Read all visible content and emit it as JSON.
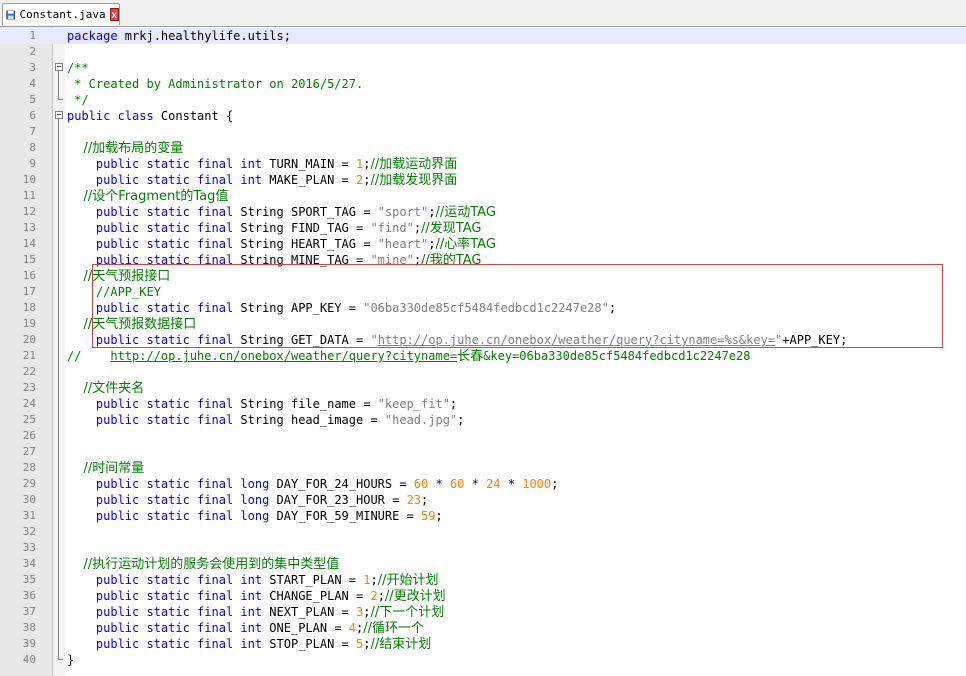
{
  "tab": {
    "title": "Constant.java",
    "close_glyph": "x"
  },
  "lines": [
    {
      "n": "1",
      "current": true,
      "segs": [
        {
          "c": "kw",
          "t": "package"
        },
        {
          "c": "",
          "t": " mrkj.healthylife.utils;"
        }
      ]
    },
    {
      "n": "2",
      "segs": []
    },
    {
      "n": "3",
      "segs": [
        {
          "c": "cm",
          "t": "/**"
        }
      ]
    },
    {
      "n": "4",
      "segs": [
        {
          "c": "cm",
          "t": " * Created by Administrator on 2016/5/27."
        }
      ]
    },
    {
      "n": "5",
      "segs": [
        {
          "c": "cm",
          "t": " */"
        }
      ]
    },
    {
      "n": "6",
      "segs": [
        {
          "c": "kw",
          "t": "public class"
        },
        {
          "c": "",
          "t": " Constant {"
        }
      ]
    },
    {
      "n": "7",
      "segs": []
    },
    {
      "n": "8",
      "segs": [
        {
          "c": "cmc",
          "t": "    //加载布局的变量"
        }
      ]
    },
    {
      "n": "9",
      "segs": [
        {
          "c": "kw",
          "t": "    public static final int"
        },
        {
          "c": "",
          "t": " TURN_MAIN = "
        },
        {
          "c": "num",
          "t": "1"
        },
        {
          "c": "",
          "t": ";"
        },
        {
          "c": "cmc",
          "t": "//加载运动界面"
        }
      ]
    },
    {
      "n": "10",
      "segs": [
        {
          "c": "kw",
          "t": "    public static final int"
        },
        {
          "c": "",
          "t": " MAKE_PLAN = "
        },
        {
          "c": "num",
          "t": "2"
        },
        {
          "c": "",
          "t": ";"
        },
        {
          "c": "cmc",
          "t": "//加载发现界面"
        }
      ]
    },
    {
      "n": "11",
      "segs": [
        {
          "c": "cmc",
          "t": "    //设个Fragment的Tag值"
        }
      ]
    },
    {
      "n": "12",
      "segs": [
        {
          "c": "kw",
          "t": "    public static final"
        },
        {
          "c": "",
          "t": " String SPORT_TAG = "
        },
        {
          "c": "str",
          "t": "\"sport\""
        },
        {
          "c": "",
          "t": ";"
        },
        {
          "c": "cmc",
          "t": "//运动TAG"
        }
      ]
    },
    {
      "n": "13",
      "segs": [
        {
          "c": "kw",
          "t": "    public static final"
        },
        {
          "c": "",
          "t": " String FIND_TAG = "
        },
        {
          "c": "str",
          "t": "\"find\""
        },
        {
          "c": "",
          "t": ";"
        },
        {
          "c": "cmc",
          "t": "//发现TAG"
        }
      ]
    },
    {
      "n": "14",
      "segs": [
        {
          "c": "kw",
          "t": "    public static final"
        },
        {
          "c": "",
          "t": " String HEART_TAG = "
        },
        {
          "c": "str",
          "t": "\"heart\""
        },
        {
          "c": "",
          "t": ";"
        },
        {
          "c": "cmc",
          "t": "//心率TAG"
        }
      ]
    },
    {
      "n": "15",
      "segs": [
        {
          "c": "kw",
          "t": "    public static final"
        },
        {
          "c": "",
          "t": " String MINE_TAG = "
        },
        {
          "c": "str",
          "t": "\"mine\""
        },
        {
          "c": "",
          "t": ";"
        },
        {
          "c": "cmc",
          "t": "//我的TAG"
        }
      ]
    },
    {
      "n": "16",
      "segs": [
        {
          "c": "cmc",
          "t": "    //天气预报接口"
        }
      ]
    },
    {
      "n": "17",
      "segs": [
        {
          "c": "cm",
          "t": "    //APP_KEY"
        }
      ]
    },
    {
      "n": "18",
      "segs": [
        {
          "c": "kw",
          "t": "    public static final"
        },
        {
          "c": "",
          "t": " String APP_KEY = "
        },
        {
          "c": "str",
          "t": "\"06ba330de85cf5484fedbcd1c2247e28\""
        },
        {
          "c": "",
          "t": ";"
        }
      ]
    },
    {
      "n": "19",
      "segs": [
        {
          "c": "cmc",
          "t": "    //天气预报数据接口"
        }
      ]
    },
    {
      "n": "20",
      "segs": [
        {
          "c": "kw",
          "t": "    public static final"
        },
        {
          "c": "",
          "t": " String GET_DATA = "
        },
        {
          "c": "str",
          "t": "\""
        },
        {
          "c": "url",
          "t": "http://op.juhe.cn/onebox/weather/query?cityname=%s&key="
        },
        {
          "c": "str",
          "t": "\""
        },
        {
          "c": "",
          "t": "+APP_KEY;"
        }
      ]
    },
    {
      "n": "21",
      "segs": [
        {
          "c": "cm",
          "t": "//    "
        },
        {
          "c": "url-c",
          "t": "http://op.juhe.cn/onebox/weather/query?cityname="
        },
        {
          "c": "cmc",
          "t": "长春"
        },
        {
          "c": "cm",
          "t": "&key=06ba330de85cf5484fedbcd1c2247e28"
        }
      ]
    },
    {
      "n": "22",
      "segs": []
    },
    {
      "n": "23",
      "segs": [
        {
          "c": "cmc",
          "t": "    //文件夹名"
        }
      ]
    },
    {
      "n": "24",
      "segs": [
        {
          "c": "kw",
          "t": "    public static final"
        },
        {
          "c": "",
          "t": " String file_name = "
        },
        {
          "c": "str",
          "t": "\"keep_fit\""
        },
        {
          "c": "",
          "t": ";"
        }
      ]
    },
    {
      "n": "25",
      "segs": [
        {
          "c": "kw",
          "t": "    public static final"
        },
        {
          "c": "",
          "t": " String head_image = "
        },
        {
          "c": "str",
          "t": "\"head.jpg\""
        },
        {
          "c": "",
          "t": ";"
        }
      ]
    },
    {
      "n": "26",
      "segs": []
    },
    {
      "n": "27",
      "segs": []
    },
    {
      "n": "28",
      "segs": [
        {
          "c": "cmc",
          "t": "    //时间常量"
        }
      ]
    },
    {
      "n": "29",
      "segs": [
        {
          "c": "kw",
          "t": "    public static final long"
        },
        {
          "c": "",
          "t": " DAY_FOR_24_HOURS = "
        },
        {
          "c": "num",
          "t": "60"
        },
        {
          "c": "op",
          "t": " * "
        },
        {
          "c": "num",
          "t": "60"
        },
        {
          "c": "op",
          "t": " * "
        },
        {
          "c": "num",
          "t": "24"
        },
        {
          "c": "op",
          "t": " * "
        },
        {
          "c": "num",
          "t": "1000"
        },
        {
          "c": "",
          "t": ";"
        }
      ]
    },
    {
      "n": "30",
      "segs": [
        {
          "c": "kw",
          "t": "    public static final long"
        },
        {
          "c": "",
          "t": " DAY_FOR_23_HOUR = "
        },
        {
          "c": "num",
          "t": "23"
        },
        {
          "c": "",
          "t": ";"
        }
      ]
    },
    {
      "n": "31",
      "segs": [
        {
          "c": "kw",
          "t": "    public static final long"
        },
        {
          "c": "",
          "t": " DAY_FOR_59_MINURE = "
        },
        {
          "c": "num",
          "t": "59"
        },
        {
          "c": "",
          "t": ";"
        }
      ]
    },
    {
      "n": "32",
      "segs": []
    },
    {
      "n": "33",
      "segs": []
    },
    {
      "n": "34",
      "segs": [
        {
          "c": "cmc",
          "t": "    //执行运动计划的服务会使用到的集中类型值"
        }
      ]
    },
    {
      "n": "35",
      "segs": [
        {
          "c": "kw",
          "t": "    public static final int"
        },
        {
          "c": "",
          "t": " START_PLAN = "
        },
        {
          "c": "num",
          "t": "1"
        },
        {
          "c": "",
          "t": ";"
        },
        {
          "c": "cmc",
          "t": "//开始计划"
        }
      ]
    },
    {
      "n": "36",
      "segs": [
        {
          "c": "kw",
          "t": "    public static final int"
        },
        {
          "c": "",
          "t": " CHANGE_PLAN = "
        },
        {
          "c": "num",
          "t": "2"
        },
        {
          "c": "",
          "t": ";"
        },
        {
          "c": "cmc",
          "t": "//更改计划"
        }
      ]
    },
    {
      "n": "37",
      "segs": [
        {
          "c": "kw",
          "t": "    public static final int"
        },
        {
          "c": "",
          "t": " NEXT_PLAN = "
        },
        {
          "c": "num",
          "t": "3"
        },
        {
          "c": "",
          "t": ";"
        },
        {
          "c": "cmc",
          "t": "//下一个计划"
        }
      ]
    },
    {
      "n": "38",
      "segs": [
        {
          "c": "kw",
          "t": "    public static final int"
        },
        {
          "c": "",
          "t": " ONE_PLAN = "
        },
        {
          "c": "num",
          "t": "4"
        },
        {
          "c": "",
          "t": ";"
        },
        {
          "c": "cmc",
          "t": "//循环一个"
        }
      ]
    },
    {
      "n": "39",
      "segs": [
        {
          "c": "kw",
          "t": "    public static final int"
        },
        {
          "c": "",
          "t": " STOP_PLAN = "
        },
        {
          "c": "num",
          "t": "5"
        },
        {
          "c": "",
          "t": ";"
        },
        {
          "c": "cmc",
          "t": "//结束计划"
        }
      ]
    },
    {
      "n": "40",
      "segs": [
        {
          "c": "",
          "t": "}"
        }
      ]
    }
  ]
}
